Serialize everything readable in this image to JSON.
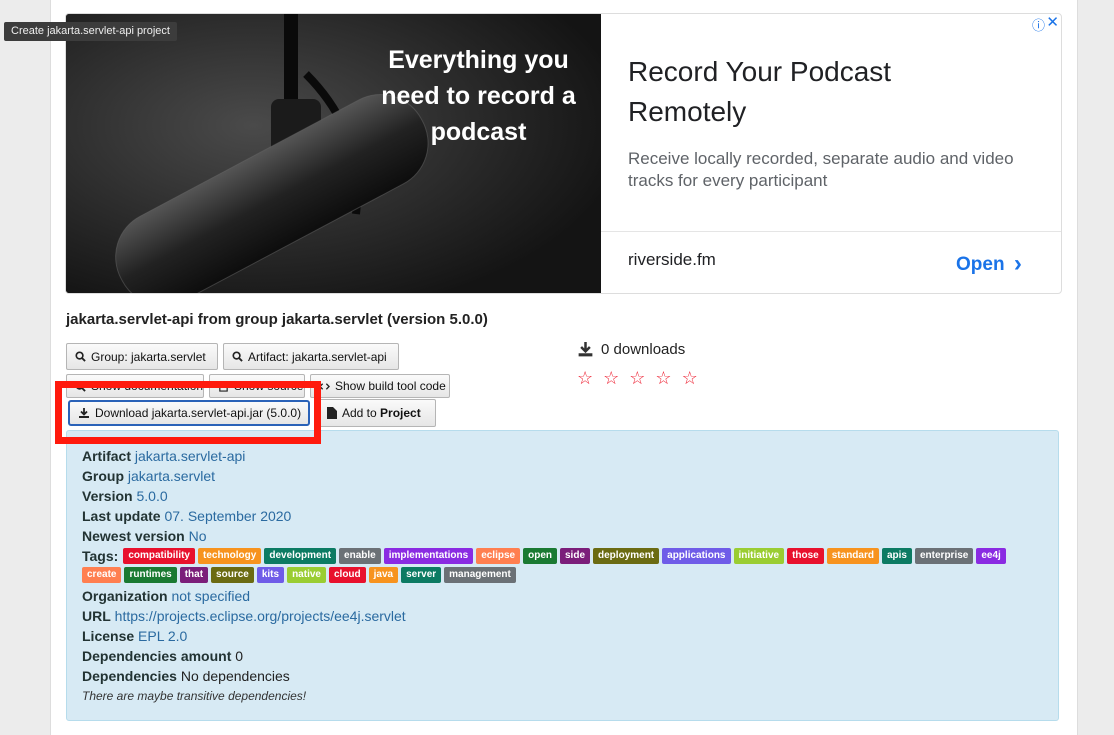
{
  "tooltip": "Create jakarta.servlet-api project",
  "ad": {
    "image_text": "Everything you need to record a podcast",
    "title": "Record Your Podcast Remotely",
    "description": "Receive locally recorded, separate audio and video tracks for every participant",
    "domain": "riverside.fm",
    "cta": "Open",
    "cta_chevron": "›",
    "info_icon": "ⓘ",
    "close_icon": "✕"
  },
  "artifact_title": "jakarta.servlet-api from group jakarta.servlet (version 5.0.0)",
  "buttons": {
    "group": "Group: jakarta.servlet",
    "artifact": "Artifact: jakarta.servlet-api",
    "show_documentation": "Show documentation",
    "show_source": "Show source",
    "show_build_tool_code": "Show build tool code",
    "download": "Download jakarta.servlet-api.jar (5.0.0)",
    "add_to_project_prefix": "Add to",
    "add_to_project_bold": "Project"
  },
  "downloads": "0 downloads",
  "stars": [
    "☆",
    "☆",
    "☆",
    "☆",
    "☆"
  ],
  "details": {
    "artifact_label": "Artifact",
    "artifact_value": "jakarta.servlet-api",
    "group_label": "Group",
    "group_value": "jakarta.servlet",
    "version_label": "Version",
    "version_value": "5.0.0",
    "last_update_label": "Last update",
    "last_update_value": "07. September 2020",
    "newest_label": "Newest version",
    "newest_value": "No",
    "tags_label": "Tags:",
    "tags": [
      {
        "text": "compatibility",
        "color": "#e8112d"
      },
      {
        "text": "technology",
        "color": "#f7931e"
      },
      {
        "text": "development",
        "color": "#0c7b63"
      },
      {
        "text": "enable",
        "color": "#6b7176"
      },
      {
        "text": "implementations",
        "color": "#8a2be2"
      },
      {
        "text": "eclipse",
        "color": "#ff7f50"
      },
      {
        "text": "open",
        "color": "#1a7a32"
      },
      {
        "text": "side",
        "color": "#7b1e7a"
      },
      {
        "text": "deployment",
        "color": "#6b6b12"
      },
      {
        "text": "applications",
        "color": "#6f5ce8"
      },
      {
        "text": "initiative",
        "color": "#9acd32"
      },
      {
        "text": "those",
        "color": "#e8112d"
      },
      {
        "text": "standard",
        "color": "#f7931e"
      },
      {
        "text": "apis",
        "color": "#0c7b63"
      },
      {
        "text": "enterprise",
        "color": "#6b7176"
      },
      {
        "text": "ee4j",
        "color": "#8a2be2"
      },
      {
        "text": "create",
        "color": "#ff7f50"
      },
      {
        "text": "runtimes",
        "color": "#1a7a32"
      },
      {
        "text": "that",
        "color": "#7b1e7a"
      },
      {
        "text": "source",
        "color": "#6b6b12"
      },
      {
        "text": "kits",
        "color": "#6f5ce8"
      },
      {
        "text": "native",
        "color": "#9acd32"
      },
      {
        "text": "cloud",
        "color": "#e8112d"
      },
      {
        "text": "java",
        "color": "#f7931e"
      },
      {
        "text": "server",
        "color": "#0c7b63"
      },
      {
        "text": "management",
        "color": "#6b7176"
      }
    ],
    "organization_label": "Organization",
    "organization_value": "not specified",
    "url_label": "URL",
    "url_value": "https://projects.eclipse.org/projects/ee4j.servlet",
    "license_label": "License",
    "license_value": "EPL 2.0",
    "dep_amount_label": "Dependencies amount",
    "dep_amount_value": "0",
    "deps_label": "Dependencies",
    "deps_value": "No dependencies",
    "note": "There are maybe transitive dependencies!"
  }
}
